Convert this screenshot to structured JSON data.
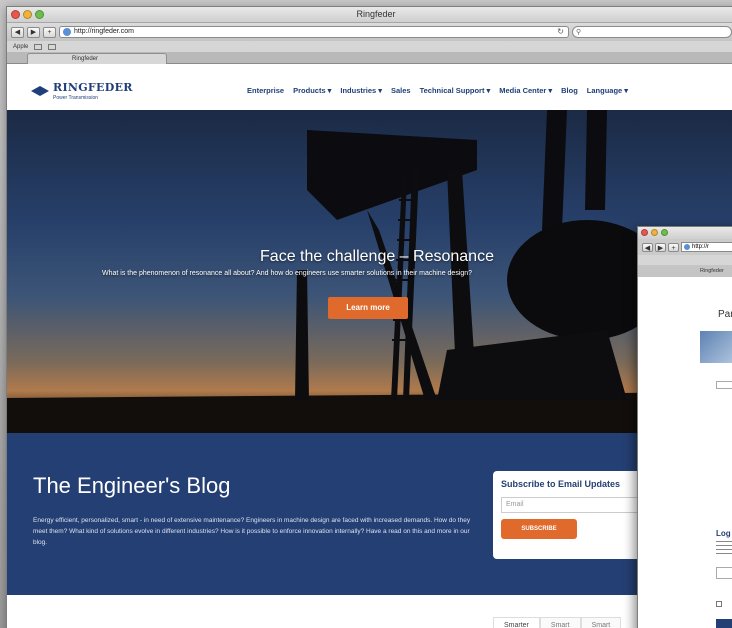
{
  "browser": {
    "title": "Ringfeder",
    "url": "http://ringfeder.com",
    "tab_label": "Ringfeder",
    "bookmarks_label": "Apple"
  },
  "site": {
    "logo_name": "RINGFEDER",
    "logo_tagline": "Power Transmission",
    "nav": [
      "Enterprise",
      "Products",
      "Industries",
      "Sales",
      "Technical Support",
      "Media Center",
      "Blog",
      "Language"
    ],
    "nav_dropdown": [
      false,
      true,
      true,
      false,
      true,
      true,
      false,
      true
    ]
  },
  "hero": {
    "title": "Face the challenge – Resonance",
    "subtitle": "What is the phenomenon of resonance all about? And how do engineers use smarter solutions in their machine design?",
    "button": "Learn more"
  },
  "blog": {
    "title": "The Engineer's Blog",
    "text": "Energy efficient, personalized, smart - in need of extensive maintenance? Engineers in machine design are faced with increased demands. How do they meet them? What kind of solutions evolve in different industries? How is it possible to enforce innovation internally? Have a read on this and more in our blog.",
    "subscribe_title": "Subscribe to Email Updates",
    "email_placeholder": "Email",
    "subscribe_button": "SUBSCRIBE"
  },
  "below": {
    "tabs": [
      "Smarter",
      "Smart",
      "Smart"
    ]
  },
  "second_window": {
    "url": "http://r",
    "tab_label": "Ringfeder",
    "heading": "Par",
    "login_label": "Log"
  },
  "colors": {
    "brand_blue": "#243f73",
    "accent_orange": "#e06a2c"
  }
}
